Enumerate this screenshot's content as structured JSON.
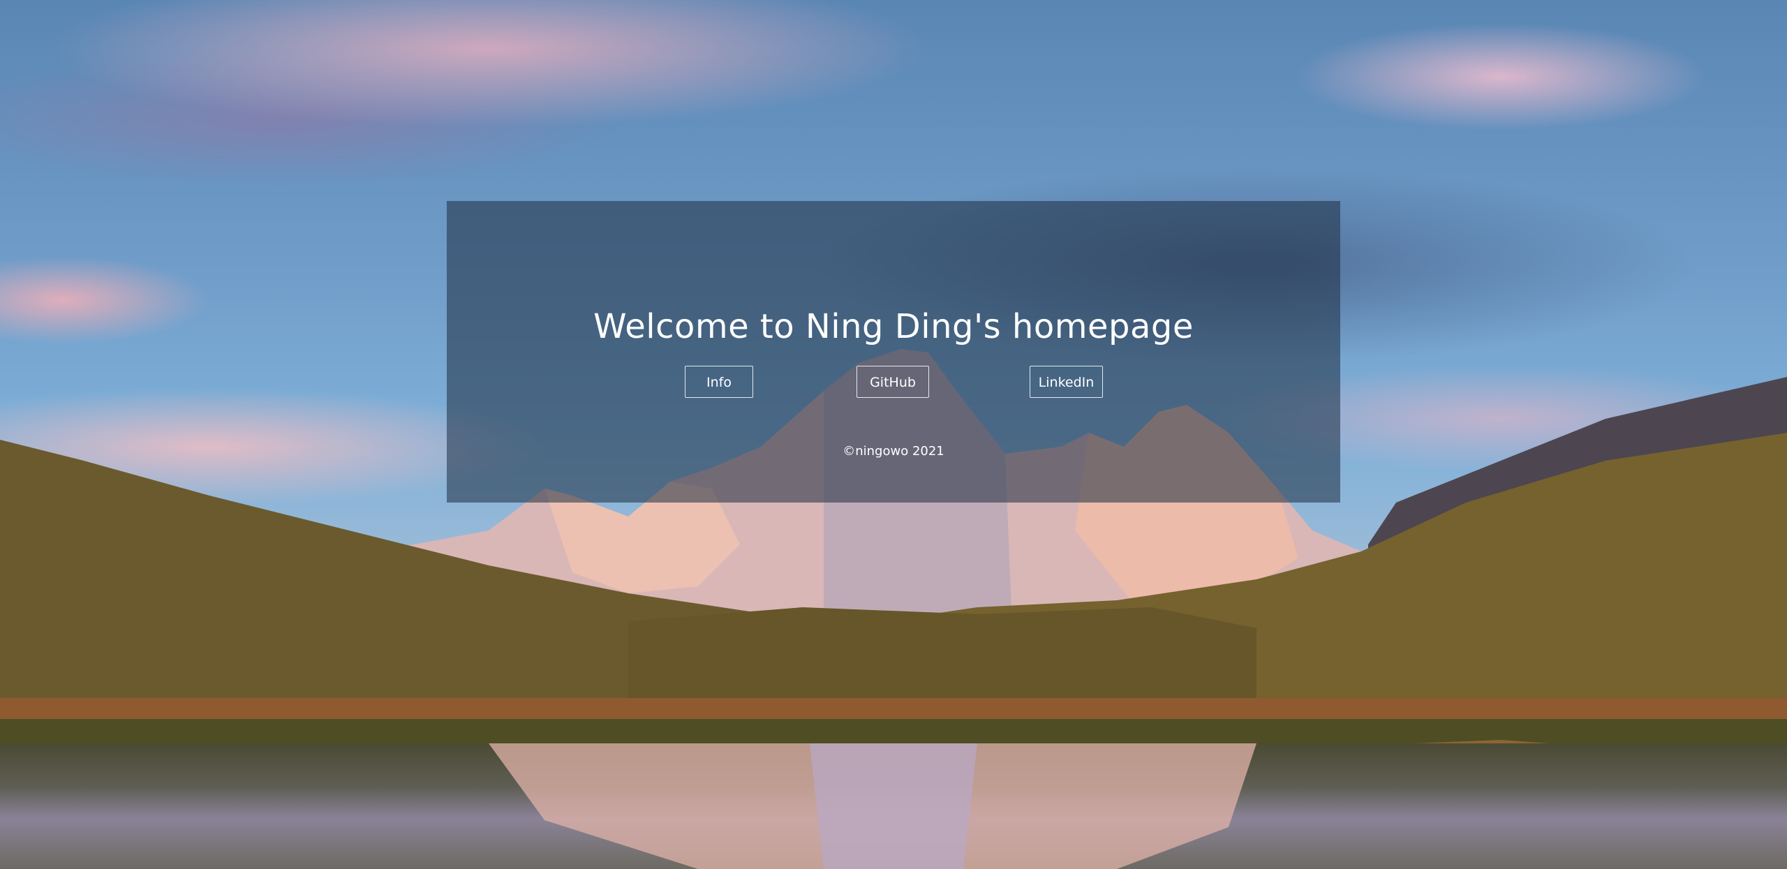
{
  "hero": {
    "title": "Welcome to Ning Ding's homepage",
    "buttons": {
      "info": "Info",
      "github": "GitHub",
      "linkedin": "LinkedIn"
    },
    "footer": "©ningowo 2021"
  },
  "background": {
    "subject": "mountain-lake-landscape",
    "colors": {
      "sky": "#6f9cc8",
      "cloud_pink": "#d7aac0",
      "peak": "#e7b9a4",
      "grass": "#6b5a2e",
      "panel": "#1e2d41"
    }
  }
}
